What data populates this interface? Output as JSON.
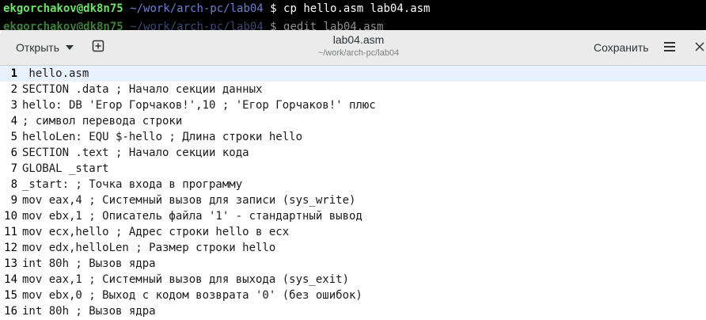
{
  "terminal": {
    "lines": [
      {
        "user": "ekgorchakov@dk8n75",
        "path": "~/work/arch-pc/lab04",
        "dollar": "$",
        "cmd": "cp hello.asm lab04.asm"
      },
      {
        "user": "ekgorchakov@dk8n75",
        "path": "~/work/arch-pc/lab04",
        "dollar": "$",
        "cmd": "gedit lab04.asm"
      }
    ]
  },
  "header": {
    "open_label": "Открыть",
    "title": "lab04.asm",
    "subtitle": "~/work/arch-pc/lab04",
    "save_label": "Сохранить"
  },
  "icons": {
    "open_menu": "chevron-down-icon",
    "new_document": "new-tab-icon",
    "main_menu": "hamburger-menu-icon",
    "close": "close-icon"
  },
  "colors": {
    "terminal_user": "#6fe26b",
    "terminal_path": "#6d7fd6",
    "current_line": "#e8f2fe",
    "headerbar": "#ebebeb"
  },
  "editor": {
    "current_line": 1,
    "lines": [
      {
        "n": "1",
        "text": " hello.asm"
      },
      {
        "n": "2",
        "text": "SECTION .data ; Начало секции данных"
      },
      {
        "n": "3",
        "text": "hello: DB 'Егор Горчаков!',10 ; 'Егор Горчаков!' плюс"
      },
      {
        "n": "4",
        "text": "; символ перевода строки"
      },
      {
        "n": "5",
        "text": "helloLen: EQU $-hello ; Длина строки hello"
      },
      {
        "n": "6",
        "text": "SECTION .text ; Начало секции кода"
      },
      {
        "n": "7",
        "text": "GLOBAL _start"
      },
      {
        "n": "8",
        "text": "_start: ; Точка входа в программу"
      },
      {
        "n": "9",
        "text": "mov eax,4 ; Системный вызов для записи (sys_write)"
      },
      {
        "n": "10",
        "text": "mov ebx,1 ; Описатель файла '1' - стандартный вывод"
      },
      {
        "n": "11",
        "text": "mov ecx,hello ; Адрес строки hello в ecx"
      },
      {
        "n": "12",
        "text": "mov edx,helloLen ; Размер строки hello"
      },
      {
        "n": "13",
        "text": "int 80h ; Вызов ядра"
      },
      {
        "n": "14",
        "text": "mov eax,1 ; Системный вызов для выхода (sys_exit)"
      },
      {
        "n": "15",
        "text": "mov ebx,0 ; Выход с кодом возврата '0' (без ошибок)"
      },
      {
        "n": "16",
        "text": "int 80h ; Вызов ядра"
      }
    ]
  }
}
